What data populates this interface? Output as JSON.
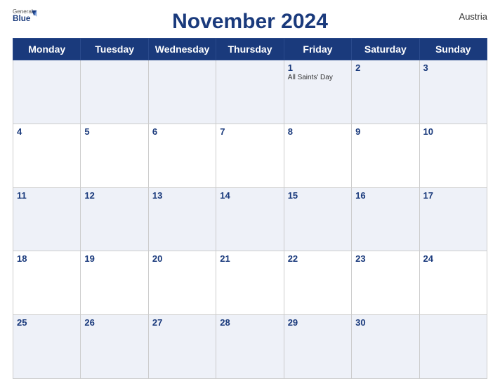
{
  "header": {
    "title": "November 2024",
    "country": "Austria",
    "logo_general": "General",
    "logo_blue": "Blue"
  },
  "days_of_week": [
    "Monday",
    "Tuesday",
    "Wednesday",
    "Thursday",
    "Friday",
    "Saturday",
    "Sunday"
  ],
  "weeks": [
    [
      {
        "num": "",
        "holiday": ""
      },
      {
        "num": "",
        "holiday": ""
      },
      {
        "num": "",
        "holiday": ""
      },
      {
        "num": "",
        "holiday": ""
      },
      {
        "num": "1",
        "holiday": "All Saints' Day"
      },
      {
        "num": "2",
        "holiday": ""
      },
      {
        "num": "3",
        "holiday": ""
      }
    ],
    [
      {
        "num": "4",
        "holiday": ""
      },
      {
        "num": "5",
        "holiday": ""
      },
      {
        "num": "6",
        "holiday": ""
      },
      {
        "num": "7",
        "holiday": ""
      },
      {
        "num": "8",
        "holiday": ""
      },
      {
        "num": "9",
        "holiday": ""
      },
      {
        "num": "10",
        "holiday": ""
      }
    ],
    [
      {
        "num": "11",
        "holiday": ""
      },
      {
        "num": "12",
        "holiday": ""
      },
      {
        "num": "13",
        "holiday": ""
      },
      {
        "num": "14",
        "holiday": ""
      },
      {
        "num": "15",
        "holiday": ""
      },
      {
        "num": "16",
        "holiday": ""
      },
      {
        "num": "17",
        "holiday": ""
      }
    ],
    [
      {
        "num": "18",
        "holiday": ""
      },
      {
        "num": "19",
        "holiday": ""
      },
      {
        "num": "20",
        "holiday": ""
      },
      {
        "num": "21",
        "holiday": ""
      },
      {
        "num": "22",
        "holiday": ""
      },
      {
        "num": "23",
        "holiday": ""
      },
      {
        "num": "24",
        "holiday": ""
      }
    ],
    [
      {
        "num": "25",
        "holiday": ""
      },
      {
        "num": "26",
        "holiday": ""
      },
      {
        "num": "27",
        "holiday": ""
      },
      {
        "num": "28",
        "holiday": ""
      },
      {
        "num": "29",
        "holiday": ""
      },
      {
        "num": "30",
        "holiday": ""
      },
      {
        "num": "",
        "holiday": ""
      }
    ]
  ]
}
